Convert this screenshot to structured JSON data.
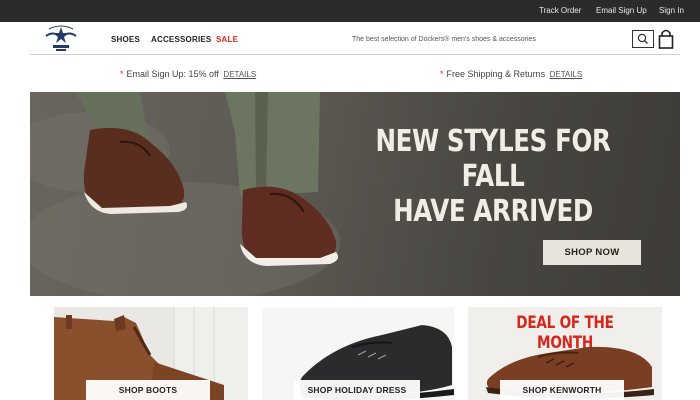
{
  "utility": {
    "track_order": "Track Order",
    "email_signup": "Email Sign Up",
    "sign_in": "Sign In"
  },
  "header": {
    "logo_text": "DOCKERS",
    "nav": [
      {
        "label": "SHOES"
      },
      {
        "label": "ACCESSORIES"
      },
      {
        "label": "SALE"
      }
    ],
    "tagline": "The best selection of Dockers® men's shoes & accessories"
  },
  "promos": [
    {
      "text": "Email Sign Up: 15% off",
      "link": "DETAILS"
    },
    {
      "text": "Free Shipping & Returns",
      "link": "DETAILS"
    }
  ],
  "hero": {
    "line1": "NEW STYLES FOR FALL",
    "line2": "HAVE ARRIVED",
    "button": "SHOP NOW"
  },
  "tiles": [
    {
      "button": "SHOP BOOTS"
    },
    {
      "button": "SHOP HOLIDAY DRESS"
    },
    {
      "heading": "DEAL OF THE MONTH",
      "button": "SHOP KENWORTH"
    }
  ],
  "colors": {
    "accent": "#d9261c",
    "utility_bar": "#2b2b2b"
  },
  "icons": [
    "search-icon",
    "shopping-bag-icon",
    "dockers-logo"
  ]
}
